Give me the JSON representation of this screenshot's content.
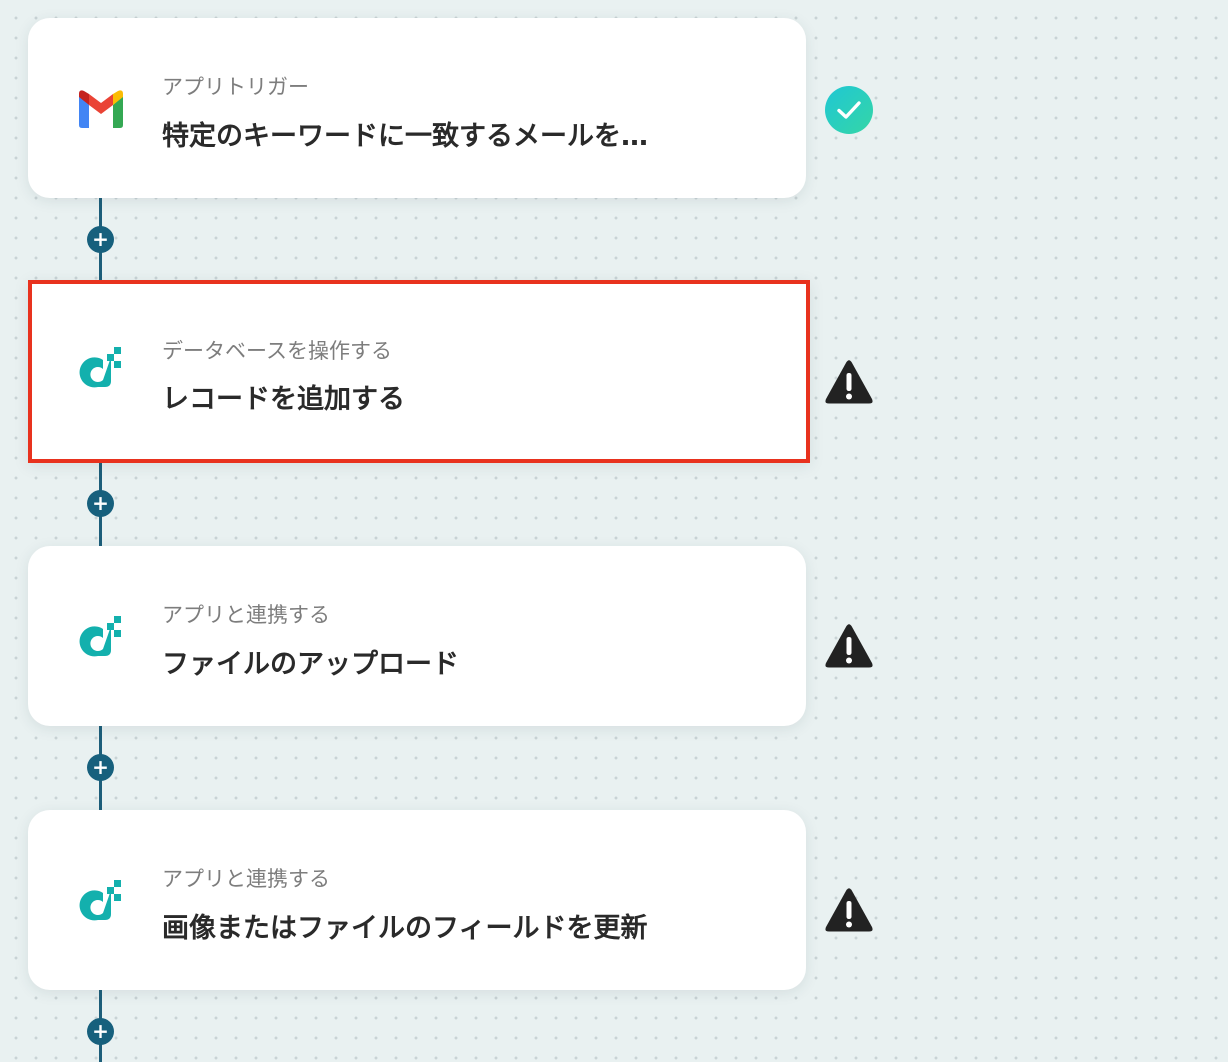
{
  "flow": {
    "steps": [
      {
        "app": "gmail",
        "icon": "gmail-icon",
        "category": "アプリトリガー",
        "title": "特定のキーワードに一致するメールを…",
        "status": "complete",
        "selected": false
      },
      {
        "app": "dify",
        "icon": "database-app-icon",
        "category": "データベースを操作する",
        "title": "レコードを追加する",
        "status": "warning",
        "selected": true
      },
      {
        "app": "dify",
        "icon": "database-app-icon",
        "category": "アプリと連携する",
        "title": "ファイルのアップロード",
        "status": "warning",
        "selected": false
      },
      {
        "app": "dify",
        "icon": "database-app-icon",
        "category": "アプリと連携する",
        "title": "画像またはファイルのフィールドを更新",
        "status": "warning",
        "selected": false
      }
    ],
    "add_button_label": "+"
  },
  "colors": {
    "background": "#e9f1f1",
    "connector": "#1d5e7a",
    "add_button": "#17607d",
    "selected_border": "#e8321e",
    "check_start": "#1fc7d4",
    "check_end": "#35d6a6",
    "warning": "#222222",
    "app_teal": "#13b0ad"
  }
}
